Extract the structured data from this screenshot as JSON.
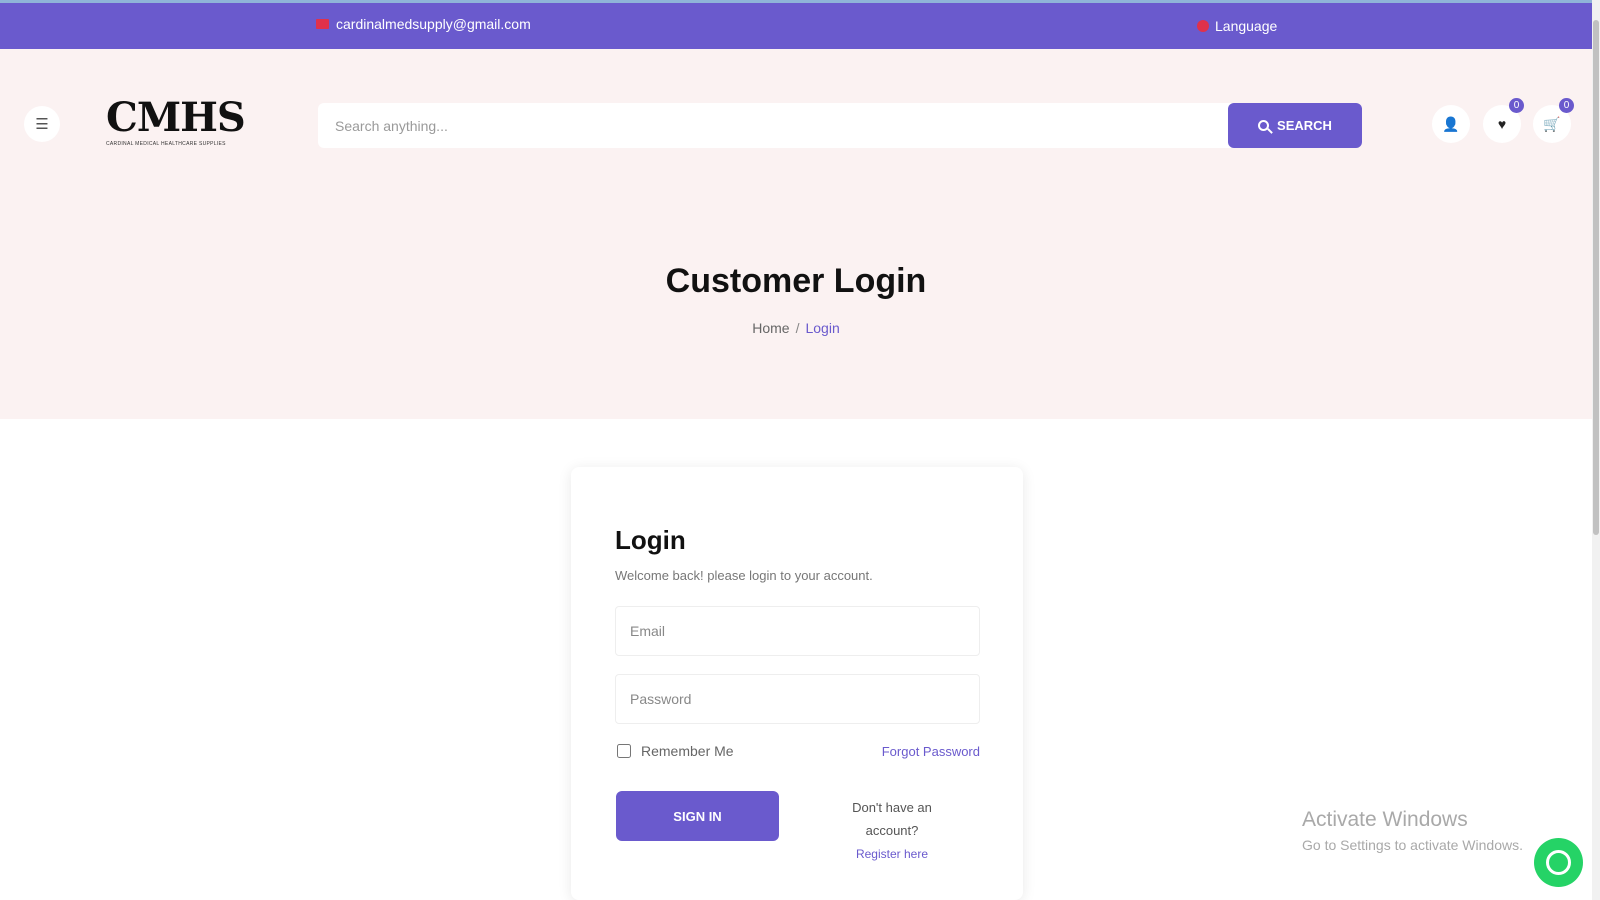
{
  "topbar": {
    "email": "cardinalmedsupply@gmail.com",
    "language": "Language"
  },
  "header": {
    "logo_text": "CMHS",
    "logo_tagline": "Cardinal Medical Healthcare Supplies",
    "search": {
      "placeholder": "Search anything...",
      "button_label": "SEARCH"
    },
    "wishlist_count": "0",
    "cart_count": "0"
  },
  "hero": {
    "title": "Customer Login",
    "breadcrumb": {
      "home": "Home",
      "separator": "/",
      "current": "Login"
    }
  },
  "login": {
    "title": "Login",
    "subtitle": "Welcome back! please login to your account.",
    "email_placeholder": "Email",
    "password_placeholder": "Password",
    "remember_label": "Remember Me",
    "forgot_label": "Forgot Password",
    "signin_label": "SIGN IN",
    "no_account_text": "Don't have an account?",
    "register_label": "Register here"
  },
  "overlay": {
    "activate_title": "Activate Windows",
    "activate_sub": "Go to Settings to activate Windows."
  },
  "colors": {
    "accent": "#6a5acd",
    "hero_bg": "#fbf2f2",
    "whatsapp": "#25d366"
  },
  "icons": [
    "mail-icon",
    "globe-icon",
    "menu-icon",
    "search-icon",
    "user-icon",
    "heart-icon",
    "cart-icon",
    "whatsapp-icon"
  ]
}
